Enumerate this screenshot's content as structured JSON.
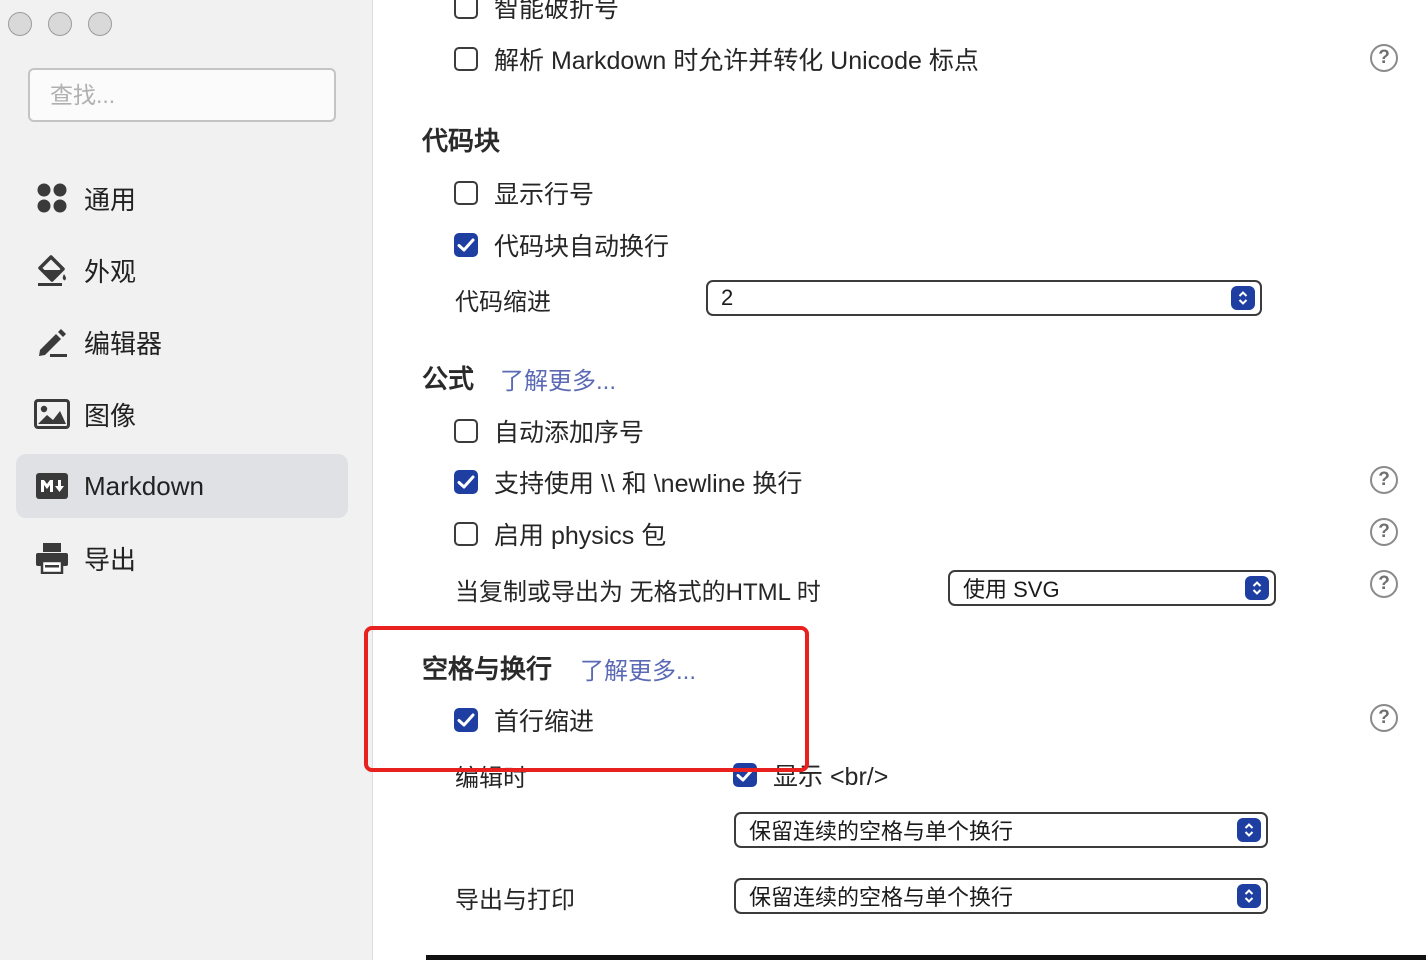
{
  "search": {
    "placeholder": "查找..."
  },
  "sidebar": {
    "items": [
      {
        "label": "通用",
        "icon": "grid-icon"
      },
      {
        "label": "外观",
        "icon": "paint-bucket-icon"
      },
      {
        "label": "编辑器",
        "icon": "pen-icon"
      },
      {
        "label": "图像",
        "icon": "image-icon"
      },
      {
        "label": "Markdown",
        "icon": "markdown-icon",
        "active": true
      },
      {
        "label": "导出",
        "icon": "printer-icon"
      }
    ]
  },
  "main": {
    "top": {
      "smart_dash": {
        "label": "智能破折号",
        "checked": false
      },
      "unicode_punct": {
        "label": "解析 Markdown 时允许并转化 Unicode 标点",
        "checked": false
      }
    },
    "code_block": {
      "title": "代码块",
      "show_line_numbers": {
        "label": "显示行号",
        "checked": false
      },
      "auto_wrap": {
        "label": "代码块自动换行",
        "checked": true
      },
      "indent_label": "代码缩进",
      "indent_value": "2"
    },
    "math": {
      "title": "公式",
      "learn_more": "了解更多...",
      "auto_number": {
        "label": "自动添加序号",
        "checked": false
      },
      "newline_support": {
        "label": "支持使用 \\\\ 和 \\newline 换行",
        "checked": true
      },
      "physics": {
        "label": "启用 physics 包",
        "checked": false
      },
      "export_label": "当复制或导出为 无格式的HTML 时",
      "export_value": "使用 SVG"
    },
    "whitespace": {
      "title": "空格与换行",
      "learn_more": "了解更多...",
      "first_line_indent": {
        "label": "首行缩进",
        "checked": true
      },
      "editing_label": "编辑时",
      "show_br": {
        "label": "显示 <br/>",
        "checked": true
      },
      "editing_value": "保留连续的空格与单个换行",
      "export_label": "导出与打印",
      "export_value": "保留连续的空格与单个换行"
    }
  },
  "colors": {
    "accent": "#1e3fa1",
    "link": "#5b6ab5",
    "highlight": "#e8201e",
    "sidebar_bg": "#f1f1f1"
  }
}
